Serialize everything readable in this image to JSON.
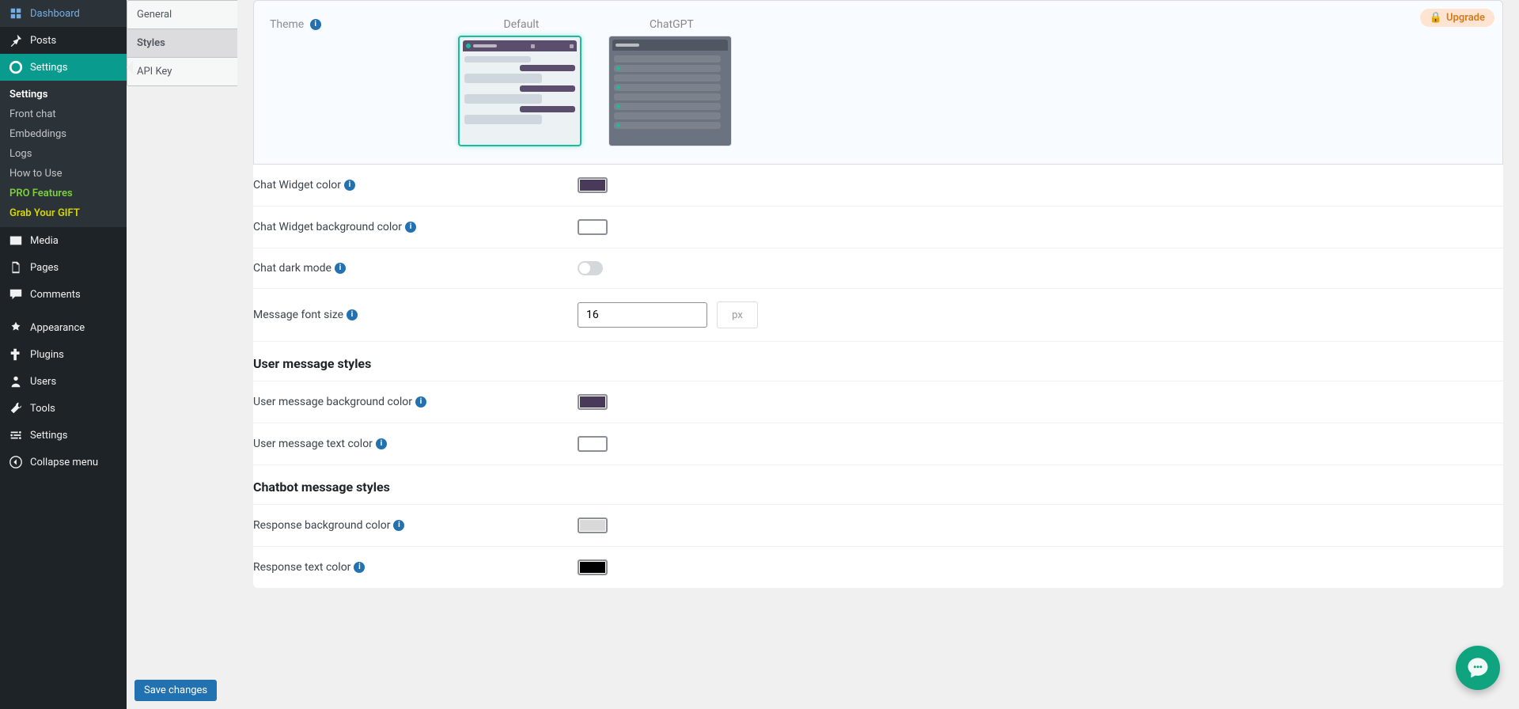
{
  "upgrade_label": "Upgrade",
  "sidebar": {
    "dashboard": "Dashboard",
    "posts": "Posts",
    "settings_plugin": "Settings",
    "sub": {
      "settings": "Settings",
      "front_chat": "Front chat",
      "embeddings": "Embeddings",
      "logs": "Logs",
      "how_to_use": "How to Use",
      "pro": "PRO Features",
      "gift": "Grab Your GIFT"
    },
    "media": "Media",
    "pages": "Pages",
    "comments": "Comments",
    "appearance": "Appearance",
    "plugins": "Plugins",
    "users": "Users",
    "tools": "Tools",
    "settings": "Settings",
    "collapse": "Collapse menu"
  },
  "tabs": {
    "general": "General",
    "styles": "Styles",
    "api": "API Key"
  },
  "theme": {
    "label": "Theme",
    "options": {
      "default": "Default",
      "chatgpt": "ChatGPT"
    },
    "selected": "default"
  },
  "fields": {
    "chat_widget_color": {
      "label": "Chat Widget color",
      "value": "#4a3a5a"
    },
    "chat_widget_bg": {
      "label": "Chat Widget background color",
      "value": "#ffffff"
    },
    "dark_mode": {
      "label": "Chat dark mode",
      "value": false
    },
    "font_size": {
      "label": "Message font size",
      "value": "16",
      "unit": "px"
    },
    "user_bg": {
      "label": "User message background color",
      "value": "#4a3a5a"
    },
    "user_text": {
      "label": "User message text color",
      "value": "#ffffff"
    },
    "response_bg": {
      "label": "Response background color",
      "value": "#d9d9d9"
    },
    "response_text": {
      "label": "Response text color",
      "value": "#000000"
    }
  },
  "sections": {
    "user_styles": "User message styles",
    "bot_styles": "Chatbot message styles"
  },
  "save": "Save changes"
}
